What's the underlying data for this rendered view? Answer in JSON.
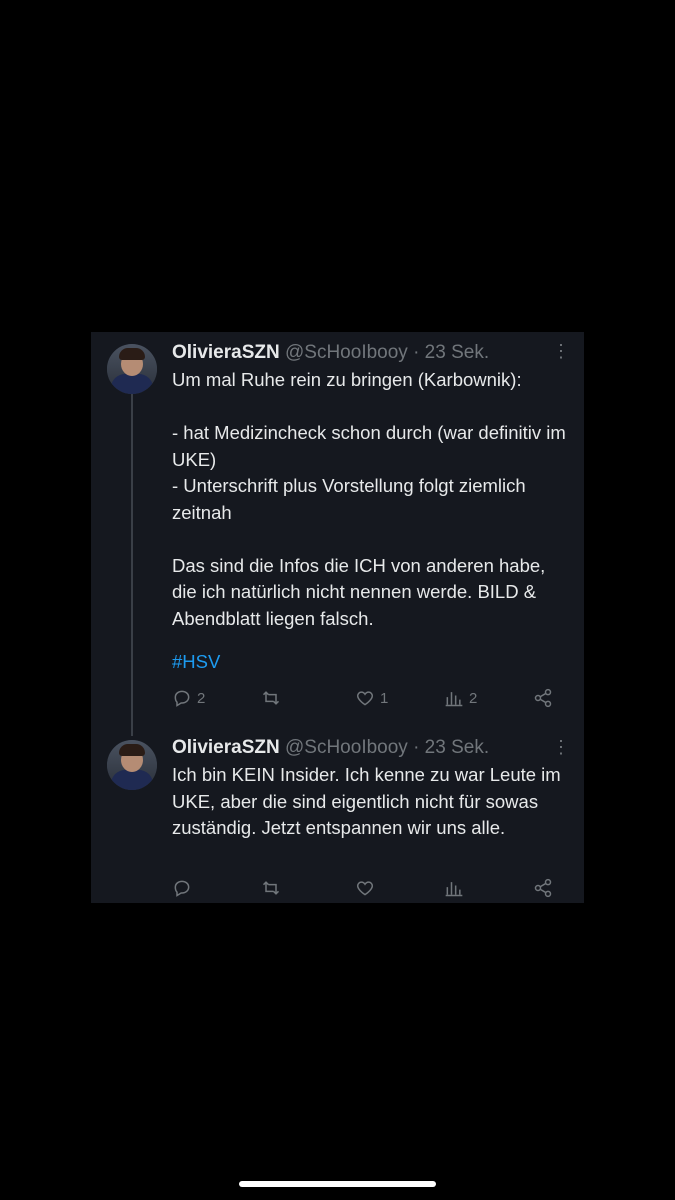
{
  "tweets": [
    {
      "author_name": "OlivieraSZN",
      "handle": "@ScHooIbooy",
      "time": "· 23 Sek.",
      "text": "Um mal Ruhe rein zu bringen (Karbownik):\n\n- hat Medizincheck schon durch (war definitiv im UKE)\n- Unterschrift plus Vorstellung folgt ziemlich zeitnah\n\nDas sind die Infos die ICH von anderen habe, die ich natürlich nicht nennen werde. BILD & Abendblatt liegen falsch.",
      "hashtag": "#HSV",
      "replies": "2",
      "retweets": "",
      "likes": "1",
      "views": "2"
    },
    {
      "author_name": "OlivieraSZN",
      "handle": "@ScHooIbooy",
      "time": "· 23 Sek.",
      "text": "Ich bin KEIN Insider. Ich kenne zu war Leute im UKE, aber die sind eigentlich nicht für sowas zuständig.  Jetzt entspannen wir uns alle.",
      "replies": "",
      "retweets": "",
      "likes": "",
      "views": ""
    }
  ],
  "icons": {
    "reply": "reply-icon",
    "retweet": "retweet-icon",
    "like": "like-icon",
    "views": "views-icon",
    "share": "share-icon",
    "more": "more-icon"
  },
  "colors": {
    "background": "#000000",
    "card": "#15181f",
    "text": "#e7e9ea",
    "muted": "#71767b",
    "link": "#1d9bf0"
  }
}
